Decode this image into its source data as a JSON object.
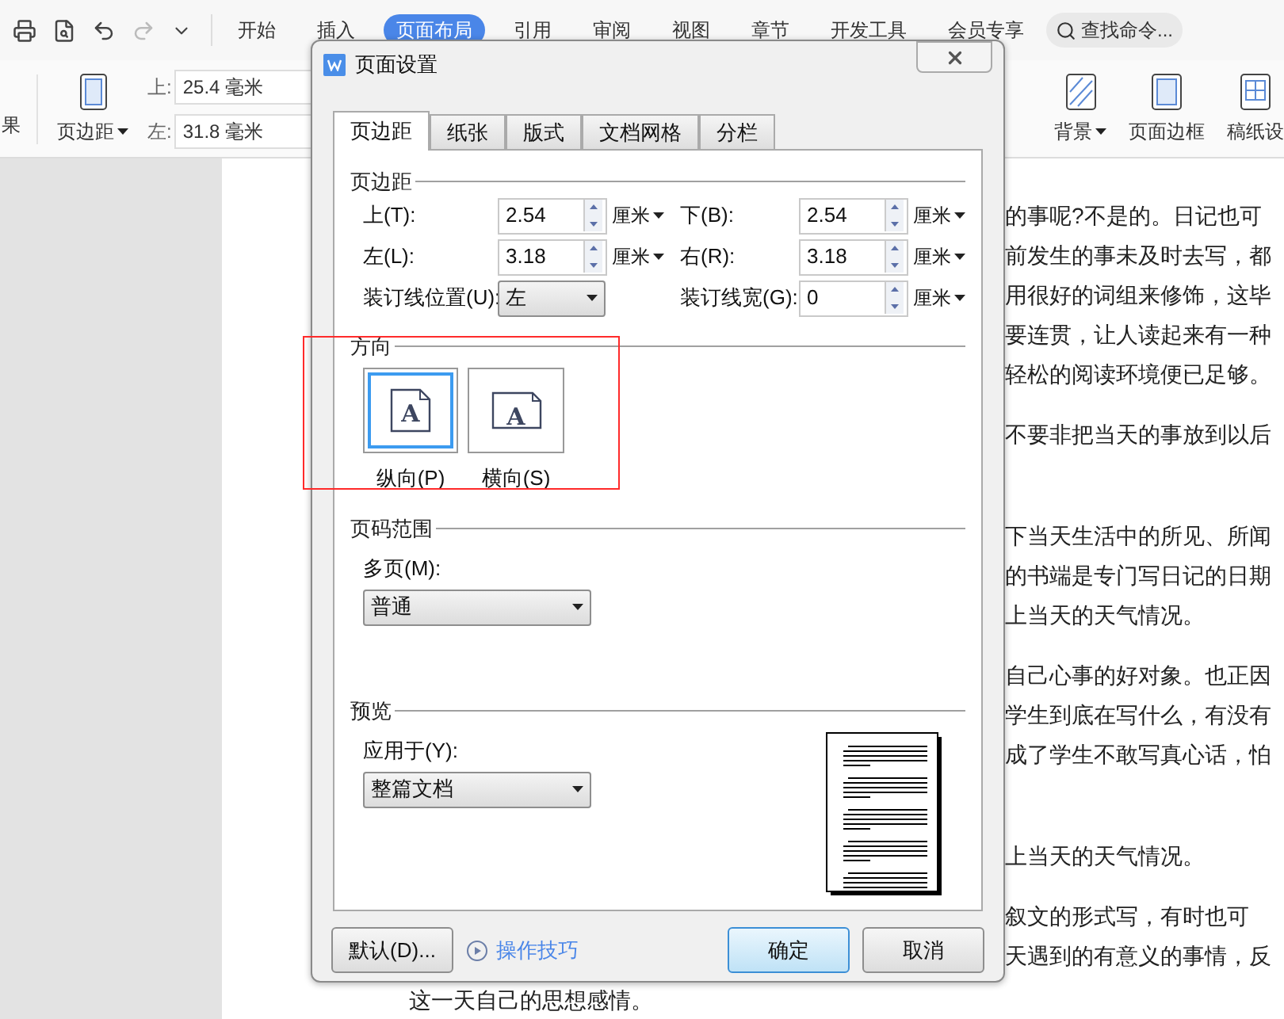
{
  "toolbar": {
    "tabs": [
      {
        "label": "开始",
        "selected": false
      },
      {
        "label": "插入",
        "selected": false
      },
      {
        "label": "页面布局",
        "selected": true
      },
      {
        "label": "引用",
        "selected": false
      },
      {
        "label": "审阅",
        "selected": false
      },
      {
        "label": "视图",
        "selected": false
      },
      {
        "label": "章节",
        "selected": false
      },
      {
        "label": "开发工具",
        "selected": false
      },
      {
        "label": "会员专享",
        "selected": false
      }
    ],
    "search": {
      "placeholder": "查找命令..."
    }
  },
  "ribbon": {
    "cut_label": "果",
    "margins_button": "页边距",
    "fields": [
      {
        "label": "上:",
        "value": "25.4 毫米"
      },
      {
        "label": "左:",
        "value": "31.8 毫米"
      }
    ],
    "right_buttons": [
      {
        "label": "背景",
        "kind": "background",
        "dropdown": true
      },
      {
        "label": "页面边框",
        "kind": "border",
        "dropdown": false
      },
      {
        "label": "稿纸设",
        "kind": "grid",
        "dropdown": false
      }
    ]
  },
  "document": {
    "paragraphs": [
      {
        "kind": "body",
        "lines": [
          {
            "text": "的事呢?不是的。日记也可",
            "covered": true
          },
          {
            "text": "前发生的事未及时去写，都",
            "covered": true
          },
          {
            "text": "用很好的词组来修饰，这毕",
            "covered": true
          },
          {
            "text": "要连贯，让人读起来有一种",
            "covered": true
          },
          {
            "text": "轻松的阅读环境便已足够。",
            "covered": true
          }
        ]
      },
      {
        "kind": "body",
        "lines": [
          {
            "text": "不要非把当天的事放到以后",
            "covered": true
          }
        ]
      },
      {
        "kind": "section_start",
        "lines": [
          {
            "text": "下当天生活中的所见、所闻",
            "covered": true
          },
          {
            "text": "的书端是专门写日记的日期",
            "covered": true
          },
          {
            "text": "上当天的天气情况。",
            "covered": true
          }
        ]
      },
      {
        "kind": "body",
        "lines": [
          {
            "text": "自己心事的好对象。也正因",
            "covered": true
          },
          {
            "text": "学生到底在写什么，有没有",
            "covered": true
          },
          {
            "text": "成了学生不敢写真心话，怕",
            "covered": true
          }
        ]
      },
      {
        "kind": "section_start",
        "lines": [
          {
            "text": "上当天的天气情况。",
            "covered": true
          }
        ]
      },
      {
        "kind": "body",
        "lines": [
          {
            "text": "叙文的形式写，有时也可",
            "covered": true
          },
          {
            "text": "天遇到的有意义的事情，反",
            "covered": true
          },
          {
            "text": "这一天自己的思想感情。",
            "covered": false
          }
        ]
      }
    ]
  },
  "dialog": {
    "title": "页面设置",
    "tabs": [
      {
        "label": "页边距",
        "selected": true
      },
      {
        "label": "纸张",
        "selected": false
      },
      {
        "label": "版式",
        "selected": false
      },
      {
        "label": "文档网格",
        "selected": false
      },
      {
        "label": "分栏",
        "selected": false
      }
    ],
    "margins": {
      "heading": "页边距",
      "fields": [
        {
          "label": "上(T):",
          "value": "2.54",
          "unit": "厘米"
        },
        {
          "label": "下(B):",
          "value": "2.54",
          "unit": "厘米"
        },
        {
          "label": "左(L):",
          "value": "3.18",
          "unit": "厘米"
        },
        {
          "label": "右(R):",
          "value": "3.18",
          "unit": "厘米"
        }
      ],
      "gutter_position": {
        "label": "装订线位置(U):",
        "value": "左"
      },
      "gutter_width": {
        "label": "装订线宽(G):",
        "value": "0",
        "unit": "厘米"
      }
    },
    "orientation": {
      "heading": "方向",
      "options": [
        {
          "label": "纵向(P)",
          "kind": "portrait",
          "icon_letter": "A",
          "selected": true
        },
        {
          "label": "横向(S)",
          "kind": "landscape",
          "icon_letter": "A",
          "selected": false
        }
      ]
    },
    "page_range": {
      "heading": "页码范围",
      "label": "多页(M):",
      "value": "普通"
    },
    "preview": {
      "heading": "预览",
      "label": "应用于(Y):",
      "value": "整篇文档"
    },
    "buttons": {
      "default": "默认(D)...",
      "tips": "操作技巧",
      "ok": "确定",
      "cancel": "取消"
    }
  }
}
